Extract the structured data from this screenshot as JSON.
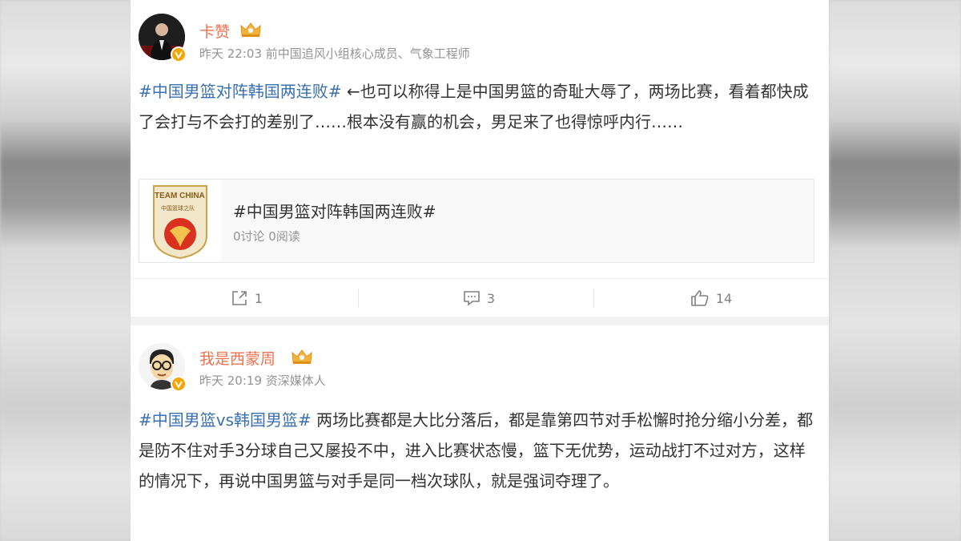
{
  "posts": [
    {
      "username": "卡赞",
      "time": "昨天 22:03",
      "bio": "前中国追风小组核心成员、气象工程师",
      "hashtag": "#中国男篮对阵韩国两连败#",
      "body": " ←也可以称得上是中国男篮的奇耻大辱了，两场比赛，看着都快成了会打与不会打的差别了……根本没有赢的机会，男足来了也得惊呼内行……",
      "topic": {
        "logo_text_top": "TEAM CHINA",
        "logo_text_sub": "中国篮球之队",
        "title": "#中国男篮对阵韩国两连败#",
        "stats": "0讨论 0阅读"
      },
      "actions": {
        "share_count": "1",
        "comment_count": "3",
        "like_count": "14"
      }
    },
    {
      "username": "我是西蒙周",
      "time": "昨天 20:19",
      "bio": "资深媒体人",
      "hashtag": "#中国男篮vs韩国男篮#",
      "body": " 两场比赛都是大比分落后，都是靠第四节对手松懈时抢分缩小分差，都是防不住对手3分球自己又屡投不中，进入比赛状态慢，篮下无优势，运动战打不过对方，这样的情况下，再说中国男篮与对手是同一档次球队，就是强词夺理了。"
    }
  ],
  "colors": {
    "username": "#eb7350",
    "hashtag": "#3a6fb0",
    "meta": "#939393",
    "verified_badge": "#f6a400"
  },
  "icons": {
    "share": "share-icon",
    "comment": "comment-icon",
    "like": "thumbs-up-icon",
    "crown": "vip-crown-icon",
    "verified": "verified-v-icon"
  }
}
